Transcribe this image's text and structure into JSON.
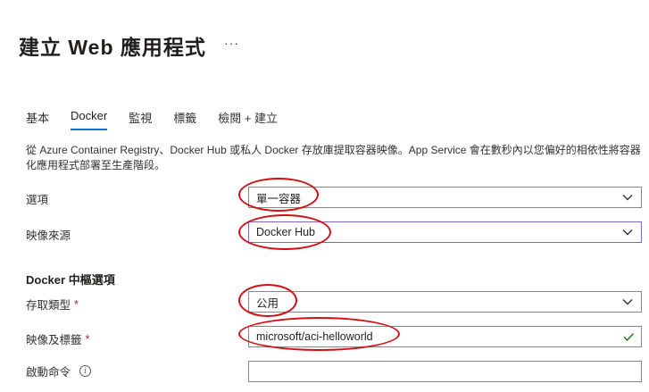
{
  "header": {
    "title": "建立 Web 應用程式",
    "more_label": "···"
  },
  "tabs": [
    {
      "label": "基本",
      "active": false
    },
    {
      "label": "Docker",
      "active": true
    },
    {
      "label": "監視",
      "active": false
    },
    {
      "label": "標籤",
      "active": false
    },
    {
      "label": "檢閱 + 建立",
      "active": false
    }
  ],
  "description": "從 Azure Container Registry、Docker Hub 或私人 Docker 存放庫提取容器映像。App Service 會在數秒內以您偏好的相依性將容器化應用程式部署至生產階段。",
  "form": {
    "options": {
      "label": "選項",
      "value": "單一容器"
    },
    "image_source": {
      "label": "映像來源",
      "value": "Docker Hub"
    },
    "section_heading": "Docker 中樞選項",
    "access_type": {
      "label": "存取類型",
      "required_mark": "*",
      "value": "公用"
    },
    "image_tag": {
      "label": "映像及標籤",
      "required_mark": "*",
      "value": "microsoft/aci-helloworld"
    },
    "startup_command": {
      "label": "啟動命令",
      "info_icon": "i",
      "value": ""
    }
  },
  "colors": {
    "accent": "#0078d4",
    "annotation_red": "#d40d12",
    "valid_green": "#107c10",
    "focus_purple": "#8764b8"
  },
  "icons": [
    "more-icon",
    "chevron-down-icon",
    "checkmark-icon",
    "info-icon"
  ]
}
